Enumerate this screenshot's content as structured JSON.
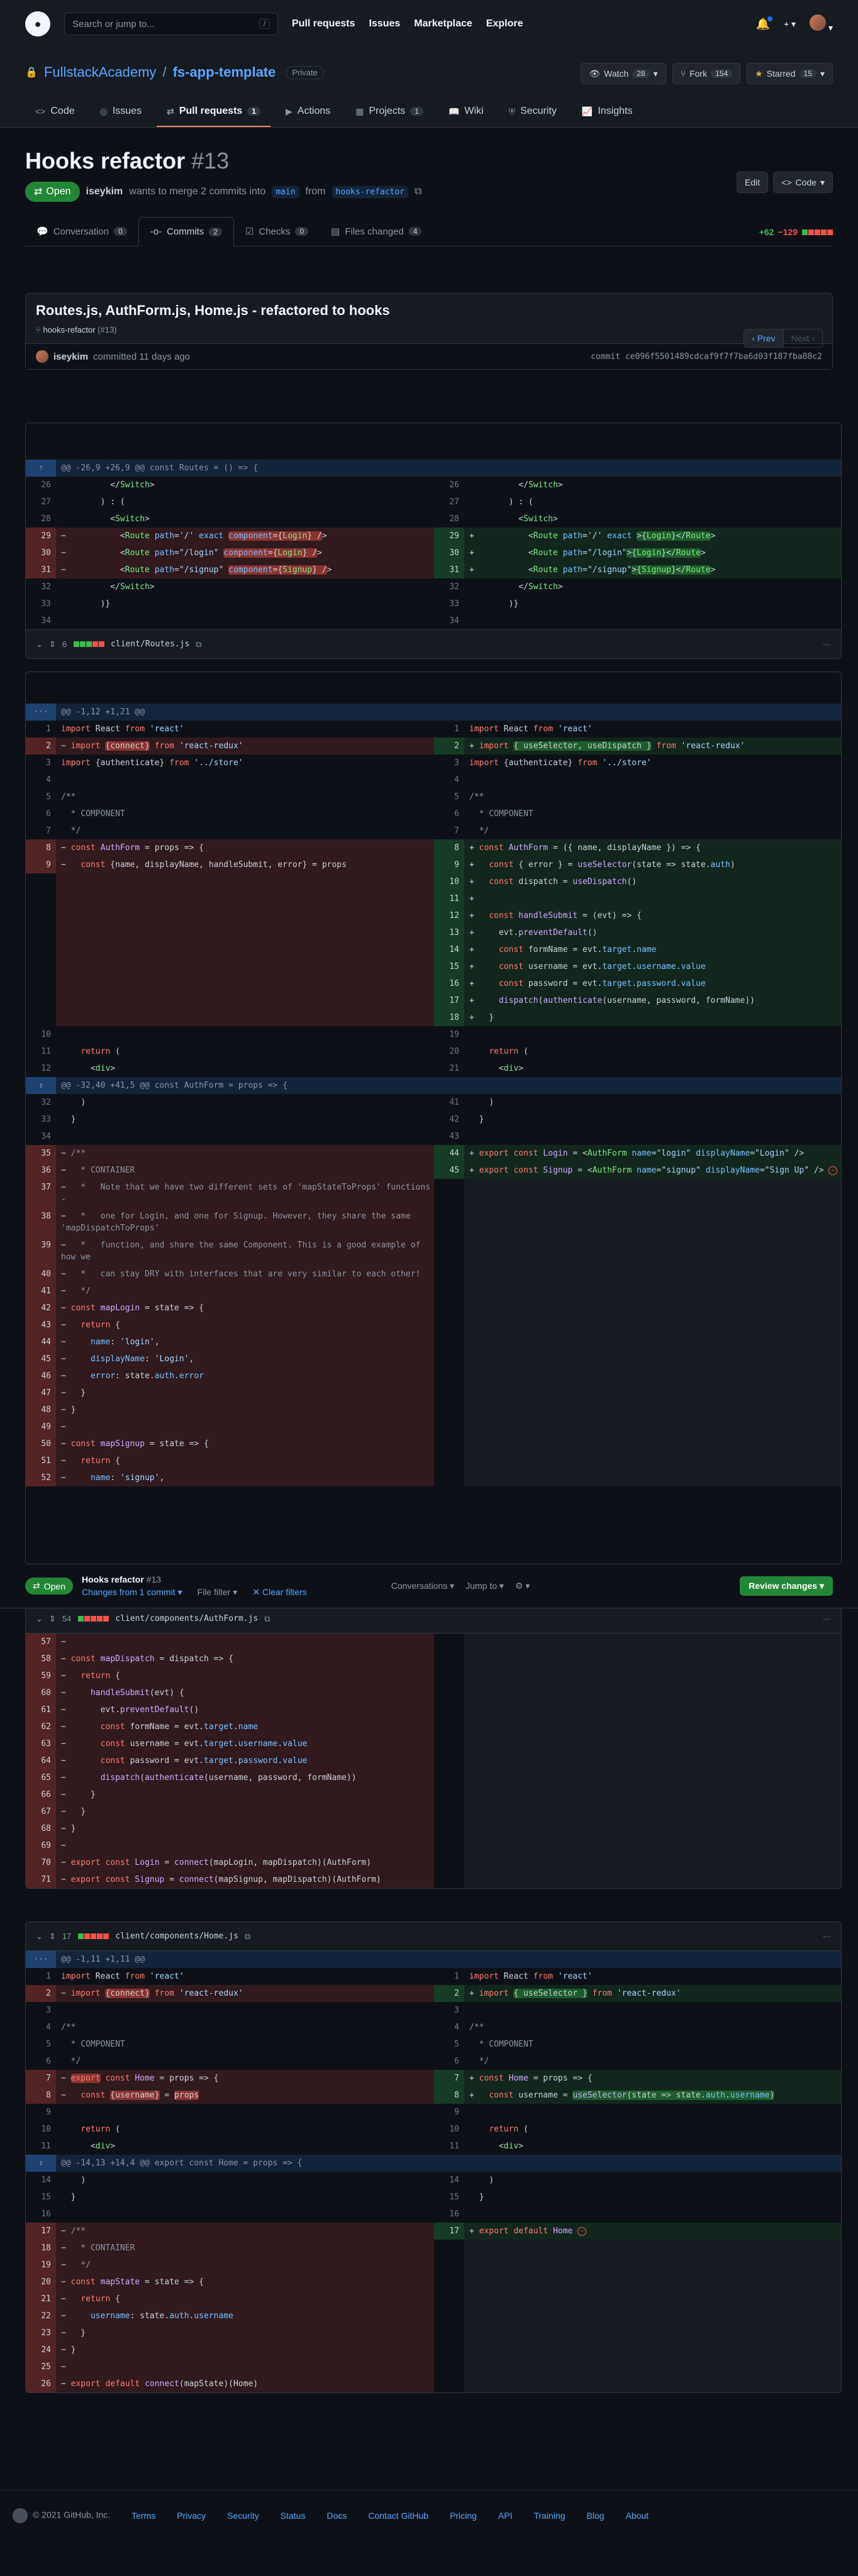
{
  "header": {
    "search_placeholder": "Search or jump to...",
    "search_key": "/",
    "nav": [
      "Pull requests",
      "Issues",
      "Marketplace",
      "Explore"
    ]
  },
  "repo": {
    "owner": "FullstackAcademy",
    "name": "fs-app-template",
    "visibility": "Private",
    "watch_label": "Watch",
    "watch_count": "28",
    "fork_label": "Fork",
    "fork_count": "154",
    "star_label": "Starred",
    "star_count": "15",
    "tabs": [
      {
        "label": "Code",
        "count": ""
      },
      {
        "label": "Issues",
        "count": ""
      },
      {
        "label": "Pull requests",
        "count": "1"
      },
      {
        "label": "Actions",
        "count": ""
      },
      {
        "label": "Projects",
        "count": "1"
      },
      {
        "label": "Wiki",
        "count": ""
      },
      {
        "label": "Security",
        "count": ""
      },
      {
        "label": "Insights",
        "count": ""
      }
    ]
  },
  "pr": {
    "title": "Hooks refactor",
    "number": "#13",
    "state": "Open",
    "author": "iseykim",
    "merge_text": "wants to merge 2 commits into",
    "base": "main",
    "from_text": "from",
    "head": "hooks-refactor",
    "edit_label": "Edit",
    "code_label": "Code",
    "tabs": [
      {
        "label": "Conversation",
        "count": "0"
      },
      {
        "label": "Commits",
        "count": "2"
      },
      {
        "label": "Checks",
        "count": "0"
      },
      {
        "label": "Files changed",
        "count": "4"
      }
    ],
    "additions": "+62",
    "deletions": "−129"
  },
  "commit": {
    "title": "Routes.js, AuthForm.js, Home.js - refactored to hooks",
    "branch": "hooks-refactor",
    "branch_pr": "(#13)",
    "prev": "Prev",
    "next": "Next",
    "author": "iseykim",
    "committed": "committed 11 days ago",
    "sha_label": "commit",
    "sha": "ce096f5501489cdcaf9f7f7ba6d03f187fba88c2"
  },
  "files": [
    {
      "name": "client/Routes.js",
      "changes": "6"
    },
    {
      "name": "client/components/AuthForm.js",
      "changes": "54"
    },
    {
      "name": "client/components/Home.js",
      "changes": "17"
    }
  ],
  "hunks": {
    "routes": "@@ -26,9 +26,9 @@ const Routes = () => {",
    "auth1": "@@ -1,12 +1,21 @@",
    "auth2": "@@ -32,40 +41,5 @@ const AuthForm = props => {",
    "home1": "@@ -1,11 +1,11 @@",
    "home2": "@@ -14,13 +14,4 @@ export const Home = props => {"
  },
  "sticky": {
    "state": "Open",
    "title": "Hooks refactor",
    "number": "#13",
    "changes_from": "Changes from 1 commit",
    "file_filter": "File filter",
    "clear_filters": "Clear filters",
    "conversations": "Conversations",
    "jump_to": "Jump to",
    "review_changes": "Review changes"
  },
  "footer": {
    "copyright": "© 2021 GitHub, Inc.",
    "links": [
      "Terms",
      "Privacy",
      "Security",
      "Status",
      "Docs",
      "Contact GitHub",
      "Pricing",
      "API",
      "Training",
      "Blog",
      "About"
    ]
  },
  "colors": {
    "background": "#0d1117",
    "header": "#161b22",
    "accent": "#58a6ff",
    "open_green": "#238636",
    "deletion": "#f85149",
    "addition": "#3fb950"
  }
}
